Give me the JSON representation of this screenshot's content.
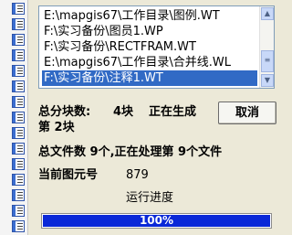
{
  "file_list": {
    "items": [
      {
        "label": "E:\\mapgis67\\工作目录\\图例.WT",
        "selected": false
      },
      {
        "label": "F:\\实习备份\\图员1.WP",
        "selected": false
      },
      {
        "label": "F:\\实习备份\\RECTFRAM.WT",
        "selected": false
      },
      {
        "label": "E:\\mapgis67\\工作目录\\合并线.WL",
        "selected": false
      },
      {
        "label": "F:\\实习备份\\注释1.WT",
        "selected": true
      }
    ]
  },
  "status": {
    "total_blocks_label": "总分块数:",
    "total_blocks_value": "4块",
    "generating_label": "正在生成",
    "current_block": "第 2块",
    "file_count_text": "总文件数  9个,正在处理第  9个文件",
    "current_element_label": "当前图元号",
    "current_element_value": "879",
    "progress_title": "运行进度"
  },
  "progress": {
    "percent": 100,
    "text": "100%"
  },
  "buttons": {
    "cancel_label": "取消"
  },
  "icons": {
    "doc_icon": "document-icon",
    "scroll_up": "arrow-up-icon",
    "scroll_down": "arrow-down-icon",
    "scroll_thumb": "grip-icon"
  },
  "colors": {
    "selection": "#316ac5",
    "progress_fill": "#0a28d8"
  }
}
